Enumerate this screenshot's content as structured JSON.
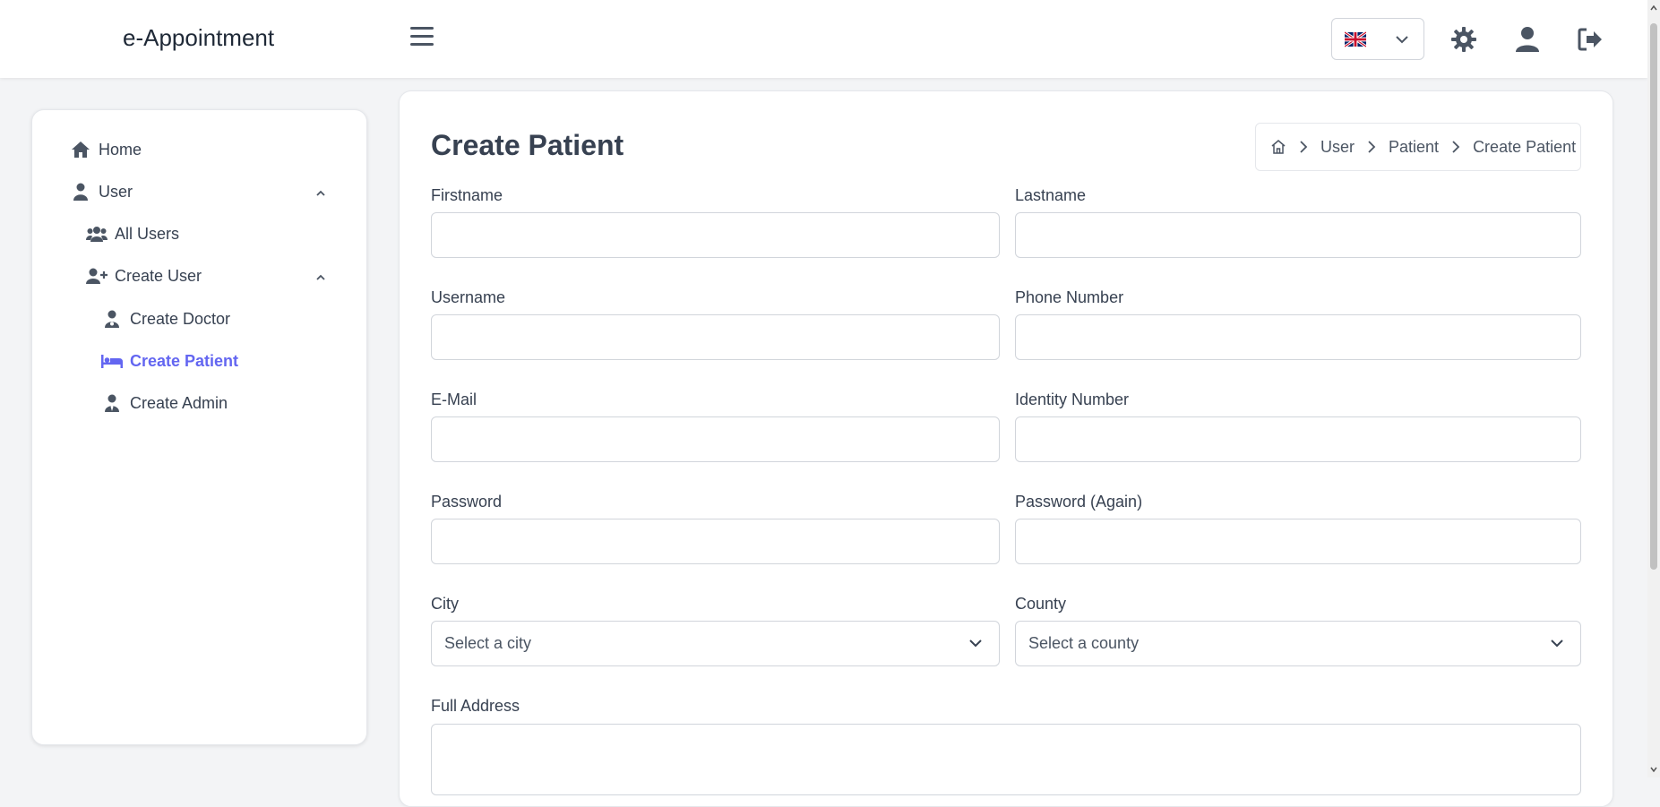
{
  "header": {
    "brand": "e-Appointment",
    "language": {
      "flag": "uk-flag-icon"
    },
    "icons": [
      "hamburger-menu-icon",
      "gear-icon",
      "user-icon",
      "logout-icon"
    ]
  },
  "sidebar": {
    "items": [
      {
        "label": "Home",
        "icon": "home-icon"
      },
      {
        "label": "User",
        "icon": "user-icon",
        "expanded": true
      },
      {
        "label": "All Users",
        "icon": "users-icon"
      },
      {
        "label": "Create User",
        "icon": "user-plus-icon",
        "expanded": true
      },
      {
        "label": "Create Doctor",
        "icon": "user-doctor-icon"
      },
      {
        "label": "Create Patient",
        "icon": "bed-icon",
        "active": true
      },
      {
        "label": "Create Admin",
        "icon": "user-tie-icon"
      }
    ],
    "active_color": "#6366f1"
  },
  "main": {
    "title": "Create Patient",
    "breadcrumb": [
      "User",
      "Patient",
      "Create Patient"
    ],
    "form": {
      "firstname": {
        "label": "Firstname",
        "value": ""
      },
      "lastname": {
        "label": "Lastname",
        "value": ""
      },
      "username": {
        "label": "Username",
        "value": ""
      },
      "phone": {
        "label": "Phone Number",
        "value": ""
      },
      "email": {
        "label": "E-Mail",
        "value": ""
      },
      "identity": {
        "label": "Identity Number",
        "value": ""
      },
      "password": {
        "label": "Password",
        "value": ""
      },
      "password_again": {
        "label": "Password (Again)",
        "value": ""
      },
      "city": {
        "label": "City",
        "selected": "Select a city"
      },
      "county": {
        "label": "County",
        "selected": "Select a county"
      },
      "address": {
        "label": "Full Address",
        "value": ""
      }
    }
  }
}
